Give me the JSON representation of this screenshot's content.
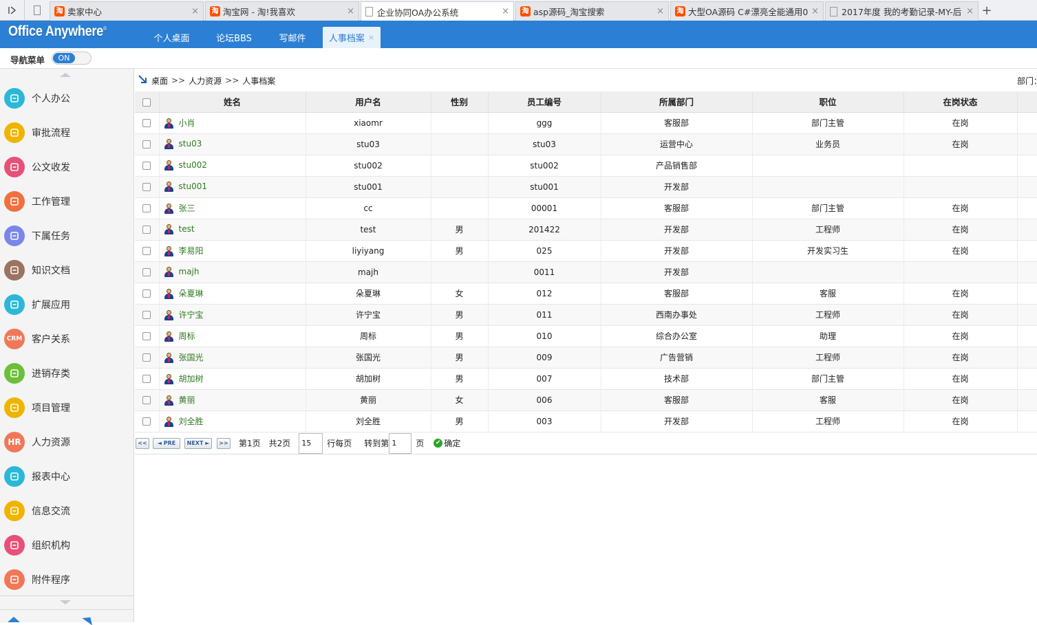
{
  "browser": {
    "tabs": [
      {
        "label": "卖家中心",
        "icon": "taobao-favicon"
      },
      {
        "label": "淘宝网 - 淘!我喜欢",
        "icon": "taobao-favicon"
      },
      {
        "label": "企业协同OA办公系统",
        "icon": "document-favicon",
        "active": true
      },
      {
        "label": "asp源码_淘宝搜索",
        "icon": "taobao-favicon"
      },
      {
        "label": "大型OA源码 C#漂亮全能通用0.",
        "icon": "taobao-favicon"
      },
      {
        "label": "2017年度 我的考勤记录-MY-后",
        "icon": "document-favicon"
      }
    ],
    "taobao_glyph": "淘",
    "close_glyph": "×",
    "new_tab_glyph": "+"
  },
  "app": {
    "logo": "Office Anywhere",
    "logo_mark": "®",
    "nav_tabs": [
      {
        "label": "个人桌面"
      },
      {
        "label": "论坛BBS"
      },
      {
        "label": "写邮件"
      },
      {
        "label": "人事档案",
        "active": true
      }
    ],
    "nav_tab_close": "×"
  },
  "menu_toggle": {
    "label": "导航菜单",
    "state": "ON"
  },
  "sidebar": {
    "items": [
      {
        "label": "个人办公",
        "icon": "person-icon",
        "color": "#2bb8d8"
      },
      {
        "label": "审批流程",
        "icon": "approval-icon",
        "color": "#f0b400"
      },
      {
        "label": "公文收发",
        "icon": "document-exchange-icon",
        "color": "#e8507a"
      },
      {
        "label": "工作管理",
        "icon": "work-icon",
        "color": "#f07040"
      },
      {
        "label": "下属任务",
        "icon": "team-task-icon",
        "color": "#7a86e8"
      },
      {
        "label": "知识文档",
        "icon": "knowledge-icon",
        "color": "#9c7360"
      },
      {
        "label": "扩展应用",
        "icon": "extension-icon",
        "color": "#2bb8d8"
      },
      {
        "label": "客户关系",
        "icon": "crm-icon",
        "color": "#f07858",
        "text": "CRM"
      },
      {
        "label": "进销存类",
        "icon": "inventory-icon",
        "color": "#6cbf3a"
      },
      {
        "label": "项目管理",
        "icon": "project-icon",
        "color": "#f0b400"
      },
      {
        "label": "人力资源",
        "icon": "hr-icon",
        "color": "#f07858",
        "text": "HR"
      },
      {
        "label": "报表中心",
        "icon": "report-icon",
        "color": "#2bb8d8"
      },
      {
        "label": "信息交流",
        "icon": "message-icon",
        "color": "#f0b400"
      },
      {
        "label": "组织机构",
        "icon": "organization-icon",
        "color": "#e8507a"
      },
      {
        "label": "附件程序",
        "icon": "attachment-icon",
        "color": "#f07858"
      }
    ]
  },
  "breadcrumb": {
    "items": [
      "桌面",
      "人力资源",
      "人事档案"
    ],
    "separator": ">>"
  },
  "dept_label": "部门：",
  "table": {
    "columns": [
      "姓名",
      "用户名",
      "性别",
      "员工编号",
      "所属部门",
      "职位",
      "在岗状态"
    ],
    "rows": [
      {
        "name": "小肖",
        "username": "xiaomr",
        "gender": "",
        "emp_no": "ggg",
        "dept": "客服部",
        "position": "部门主管",
        "status": "在岗"
      },
      {
        "name": "stu03",
        "username": "stu03",
        "gender": "",
        "emp_no": "stu03",
        "dept": "运营中心",
        "position": "业务员",
        "status": "在岗"
      },
      {
        "name": "stu002",
        "username": "stu002",
        "gender": "",
        "emp_no": "stu002",
        "dept": "产品销售部",
        "position": "",
        "status": ""
      },
      {
        "name": "stu001",
        "username": "stu001",
        "gender": "",
        "emp_no": "stu001",
        "dept": "开发部",
        "position": "",
        "status": ""
      },
      {
        "name": "张三",
        "username": "cc",
        "gender": "",
        "emp_no": "00001",
        "dept": "客服部",
        "position": "部门主管",
        "status": "在岗"
      },
      {
        "name": "test",
        "username": "test",
        "gender": "男",
        "emp_no": "201422",
        "dept": "开发部",
        "position": "工程师",
        "status": "在岗"
      },
      {
        "name": "李易阳",
        "username": "liyiyang",
        "gender": "男",
        "emp_no": "025",
        "dept": "开发部",
        "position": "开发实习生",
        "status": "在岗"
      },
      {
        "name": "majh",
        "username": "majh",
        "gender": "",
        "emp_no": "0011",
        "dept": "开发部",
        "position": "",
        "status": ""
      },
      {
        "name": "朵夏琳",
        "username": "朵夏琳",
        "gender": "女",
        "emp_no": "012",
        "dept": "客服部",
        "position": "客服",
        "status": "在岗"
      },
      {
        "name": "许宁宝",
        "username": "许宁宝",
        "gender": "男",
        "emp_no": "011",
        "dept": "西南办事处",
        "position": "工程师",
        "status": "在岗"
      },
      {
        "name": "周标",
        "username": "周标",
        "gender": "男",
        "emp_no": "010",
        "dept": "综合办公室",
        "position": "助理",
        "status": "在岗"
      },
      {
        "name": "张国光",
        "username": "张国光",
        "gender": "男",
        "emp_no": "009",
        "dept": "广告营销",
        "position": "工程师",
        "status": "在岗"
      },
      {
        "name": "胡加树",
        "username": "胡加树",
        "gender": "男",
        "emp_no": "007",
        "dept": "技术部",
        "position": "部门主管",
        "status": "在岗"
      },
      {
        "name": "黄丽",
        "username": "黄丽",
        "gender": "女",
        "emp_no": "006",
        "dept": "客服部",
        "position": "客服",
        "status": "在岗"
      },
      {
        "name": "刘全胜",
        "username": "刘全胜",
        "gender": "男",
        "emp_no": "003",
        "dept": "开发部",
        "position": "工程师",
        "status": "在岗"
      }
    ]
  },
  "pager": {
    "first_glyph": "<<",
    "prev_label": "PRE",
    "next_label": "NEXT",
    "last_glyph": ">>",
    "current_page": "第1页",
    "total_pages": "共2页",
    "rows_per_page_value": "15",
    "rows_per_page_label": "行每页",
    "goto_label": "转到第",
    "goto_value": "1",
    "page_suffix": "页",
    "confirm_label": "确定"
  }
}
